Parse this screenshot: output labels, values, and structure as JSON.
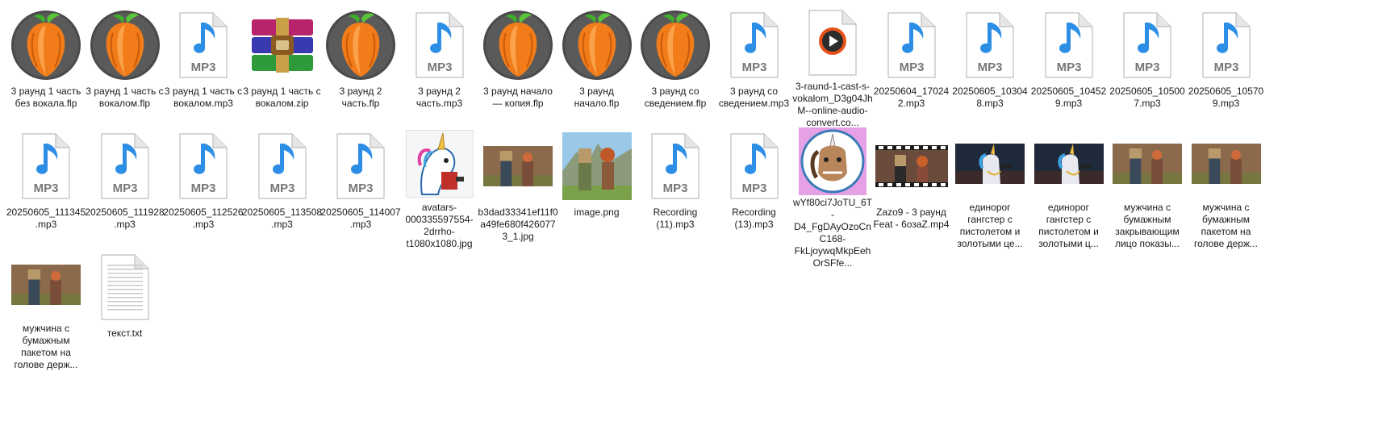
{
  "colors": {
    "fl_orange": "#f27c1a",
    "fl_dark": "#4a4a4a",
    "mp3_blue": "#2d8ee6",
    "page_bg": "#ffffff"
  },
  "icon_text": {
    "mp3": "MP3"
  },
  "files": [
    {
      "label": "3 раунд 1 часть без вокала.flp",
      "icon": "fl-studio-icon"
    },
    {
      "label": "3 раунд 1 часть с вокалом.flp",
      "icon": "fl-studio-icon"
    },
    {
      "label": "3 раунд 1 часть с вокалом.mp3",
      "icon": "mp3-file-icon"
    },
    {
      "label": "3 раунд 1 часть с вокалом.zip",
      "icon": "winrar-archive-icon"
    },
    {
      "label": "3 раунд 2 часть.flp",
      "icon": "fl-studio-icon"
    },
    {
      "label": "3 раунд 2 часть.mp3",
      "icon": "mp3-file-icon"
    },
    {
      "label": "3 раунд начало — копия.flp",
      "icon": "fl-studio-icon"
    },
    {
      "label": "3 раунд начало.flp",
      "icon": "fl-studio-icon"
    },
    {
      "label": "3 раунд со сведением.flp",
      "icon": "fl-studio-icon"
    },
    {
      "label": "3 раунд со сведением.mp3",
      "icon": "mp3-file-icon"
    },
    {
      "label": "3-raund-1-cast-s-vokalom_D3g04JhM--online-audio-convert.co...",
      "icon": "media-player-file-icon"
    },
    {
      "label": "20250604_170242.mp3",
      "icon": "mp3-file-icon"
    },
    {
      "label": "20250605_103048.mp3",
      "icon": "mp3-file-icon"
    },
    {
      "label": "20250605_104529.mp3",
      "icon": "mp3-file-icon"
    },
    {
      "label": "20250605_105007.mp3",
      "icon": "mp3-file-icon"
    },
    {
      "label": "20250605_105709.mp3",
      "icon": "mp3-file-icon"
    },
    {
      "label": "20250605_111345.mp3",
      "icon": "mp3-file-icon"
    },
    {
      "label": "20250605_111928.mp3",
      "icon": "mp3-file-icon"
    },
    {
      "label": "20250605_112526.mp3",
      "icon": "mp3-file-icon"
    },
    {
      "label": "20250605_113508.mp3",
      "icon": "mp3-file-icon"
    },
    {
      "label": "20250605_114007.mp3",
      "icon": "mp3-file-icon"
    },
    {
      "label": "avatars-000335597554-2drrho-t1080x1080.jpg",
      "icon": "unicorn-cartoon-thumbnail"
    },
    {
      "label": "b3dad33341ef11f0a49fe680f4260773_1.jpg",
      "icon": "photo-paper-bag-couple-thumbnail"
    },
    {
      "label": "image.png",
      "icon": "illustration-couple-thumbnail"
    },
    {
      "label": "Recording (11).mp3",
      "icon": "mp3-file-icon"
    },
    {
      "label": "Recording (13).mp3",
      "icon": "mp3-file-icon"
    },
    {
      "label": "wYf80ci7JoTU_6T-D4_FgDAyOzoCnC168-FkLjoywqMkpEehOrSFfe...",
      "icon": "unicorn-avatar-thumbnail"
    },
    {
      "label": "Zazo9 - 3 раунд Feat - 6озаZ.mp4",
      "icon": "video-thumbnail"
    },
    {
      "label": "единорог гангстер с пистолетом и золотыми це...",
      "icon": "photo-unicorn-gangster-thumbnail"
    },
    {
      "label": "единорог гангстер с пистолетом и золотыми ц...",
      "icon": "photo-unicorn-gangster-thumbnail"
    },
    {
      "label": "мужчина с бумажным закрывающим лицо показы...",
      "icon": "photo-paper-bag-couple-thumbnail"
    },
    {
      "label": "мужчина с бумажным пакетом на голове держ...",
      "icon": "photo-paper-bag-couple-thumbnail"
    },
    {
      "label": "мужчина с бумажным пакетом на голове держ...",
      "icon": "photo-paper-bag-couple-thumbnail"
    },
    {
      "label": "текст.txt",
      "icon": "text-file-icon"
    }
  ]
}
